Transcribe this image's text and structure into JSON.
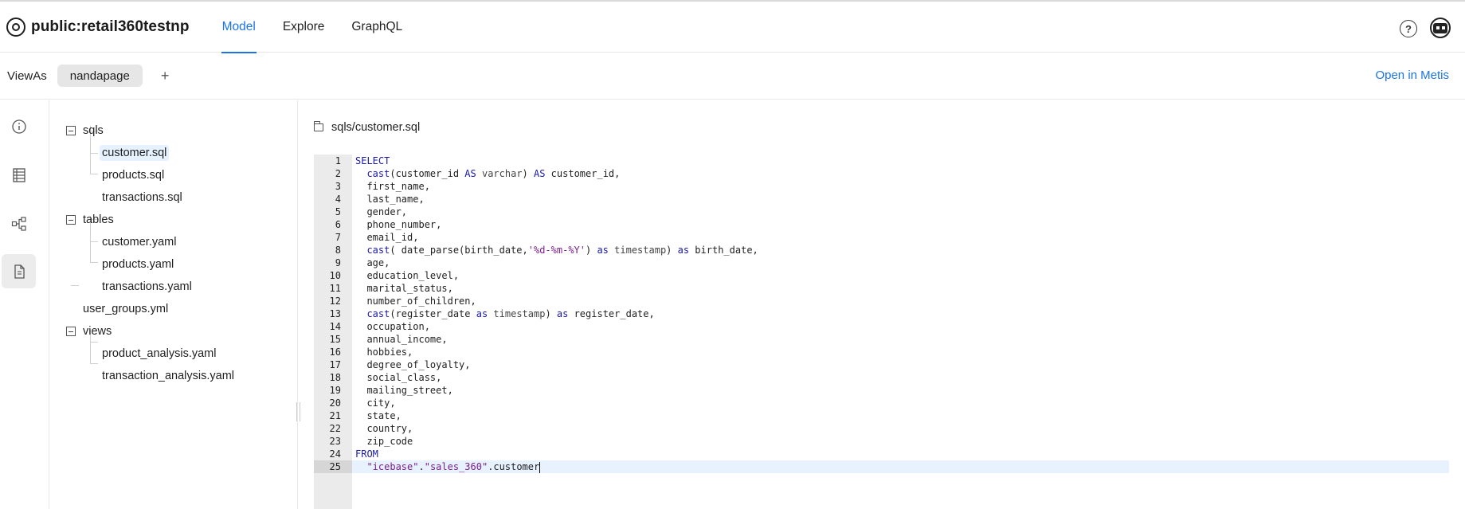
{
  "app": {
    "title": "public:retail360testnp",
    "tabs": [
      {
        "label": "Model",
        "active": true
      },
      {
        "label": "Explore",
        "active": false
      },
      {
        "label": "GraphQL",
        "active": false
      }
    ],
    "help_icon": "help-circle-icon",
    "avatar_icon": "user-avatar-icon"
  },
  "viewas": {
    "label": "ViewAs",
    "chip": "nandapage",
    "add_label": "+",
    "open_link": "Open in Metis"
  },
  "rail": {
    "items": [
      {
        "icon": "info-icon",
        "active": false
      },
      {
        "icon": "table-icon",
        "active": false
      },
      {
        "icon": "lineage-icon",
        "active": false
      },
      {
        "icon": "file-icon",
        "active": true
      }
    ]
  },
  "tree": {
    "folders": [
      {
        "name": "sqls",
        "files": [
          "customer.sql",
          "products.sql",
          "transactions.sql"
        ]
      },
      {
        "name": "tables",
        "files": [
          "customer.yaml",
          "products.yaml",
          "transactions.yaml"
        ]
      },
      {
        "name": "user_groups.yml",
        "files": []
      },
      {
        "name": "views",
        "files": [
          "product_analysis.yaml",
          "transaction_analysis.yaml"
        ]
      }
    ],
    "selected": "customer.sql"
  },
  "editor": {
    "path": "sqls/customer.sql",
    "current_line": 25,
    "lines": [
      "SELECT",
      "  cast(customer_id AS varchar) AS customer_id,",
      "  first_name,",
      "  last_name,",
      "  gender,",
      "  phone_number,",
      "  email_id,",
      "  cast( date_parse(birth_date,'%d-%m-%Y') as timestamp) as birth_date,",
      "  age,",
      "  education_level,",
      "  marital_status,",
      "  number_of_children,",
      "  cast(register_date as timestamp) as register_date,",
      "  occupation,",
      "  annual_income,",
      "  hobbies,",
      "  degree_of_loyalty,",
      "  social_class,",
      "  mailing_street,",
      "  city,",
      "  state,",
      "  country,",
      "  zip_code",
      "FROM",
      "  \"icebase\".\"sales_360\".customer"
    ]
  },
  "colors": {
    "accent": "#1a73e8",
    "keyword": "#1a1aa6",
    "string": "#7a1e8c"
  }
}
